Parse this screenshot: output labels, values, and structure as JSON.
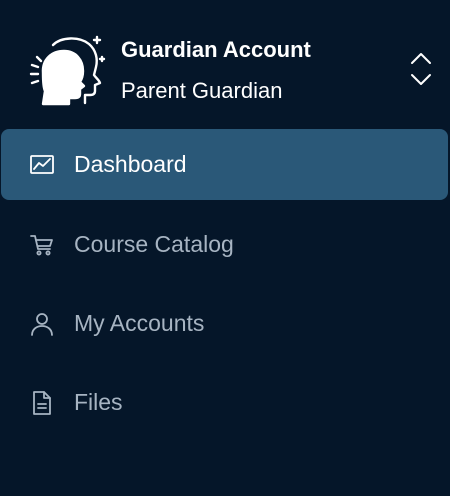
{
  "account": {
    "name": "Guardian Account",
    "role": "Parent Guardian",
    "avatar_icon": "guardian-head-icon",
    "switcher_icon": "chevron-up-down-icon"
  },
  "nav": {
    "items": [
      {
        "label": "Dashboard",
        "icon": "chart-line-icon",
        "active": true
      },
      {
        "label": "Course Catalog",
        "icon": "cart-icon",
        "active": false
      },
      {
        "label": "My Accounts",
        "icon": "user-icon",
        "active": false
      },
      {
        "label": "Files",
        "icon": "file-icon",
        "active": false
      }
    ]
  },
  "colors": {
    "background": "#051629",
    "active_background": "#2a5878",
    "active_text": "#ffffff",
    "inactive_text": "#a7b4c2"
  }
}
